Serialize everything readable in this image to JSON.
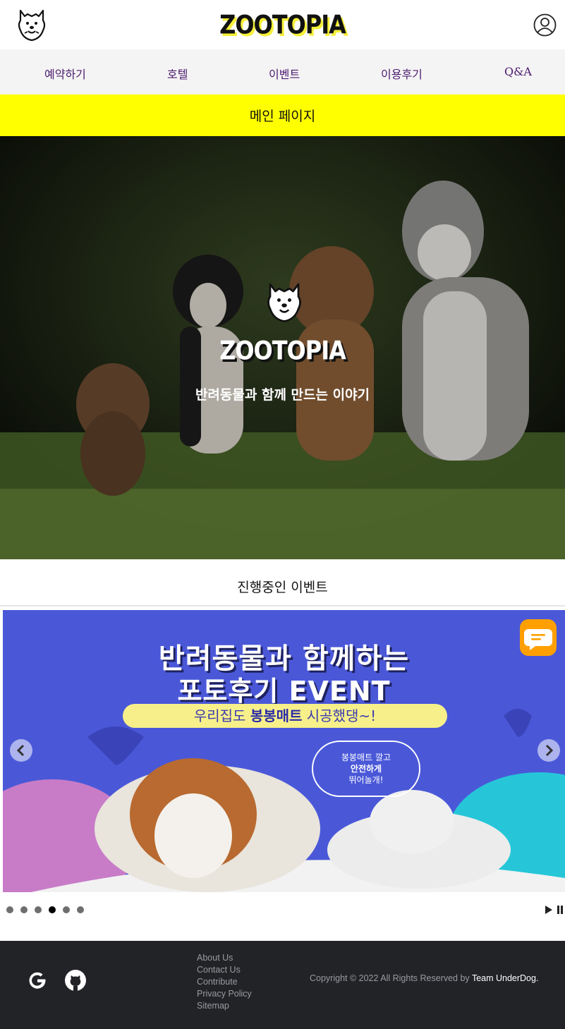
{
  "header": {
    "brand": "ZOOTOPIA",
    "logo_icon": "dog-face-icon",
    "user_icon": "user-circle-icon"
  },
  "nav": {
    "items": [
      {
        "label": "예약하기"
      },
      {
        "label": "호텔"
      },
      {
        "label": "이벤트"
      },
      {
        "label": "이용후기"
      },
      {
        "label": "Q&A"
      }
    ],
    "color": "#4b1a6e"
  },
  "page_title": "메인 페이지",
  "hero": {
    "brand": "ZOOTOPIA",
    "tagline": "반려동물과 함께 만드는 이야기"
  },
  "events": {
    "title": "진행중인 이벤트",
    "slide": {
      "line1": "반려동물과 함께하는",
      "line2": "포토후기 EVENT",
      "pill_prefix": "우리집도 ",
      "pill_bold": "봉봉매트",
      "pill_suffix": " 시공했댕~!",
      "bubble_line1": "봉봉매트 깔고",
      "bubble_line2": "안전하게",
      "bubble_line3": "뛰어놀개!",
      "background": "#4a58d8"
    },
    "dots": {
      "count": 6,
      "active_index": 3
    },
    "controls": {
      "prev_icon": "chevron-left-icon",
      "next_icon": "chevron-right-icon",
      "play_icon": "play-icon",
      "pause_icon": "pause-icon",
      "chat_icon": "chat-bubble-icon"
    }
  },
  "footer": {
    "social_icons": [
      "google-icon",
      "github-icon"
    ],
    "links": [
      "About Us",
      "Contact Us",
      "Contribute",
      "Privacy Policy",
      "Sitemap"
    ],
    "copyright_prefix": "Copyright © 2022 All Rights Reserved by ",
    "copyright_team": "Team UnderDog."
  },
  "colors": {
    "title_bar": "#ffff00",
    "footer_bg": "#222327",
    "chat_button": "#ffa000"
  }
}
